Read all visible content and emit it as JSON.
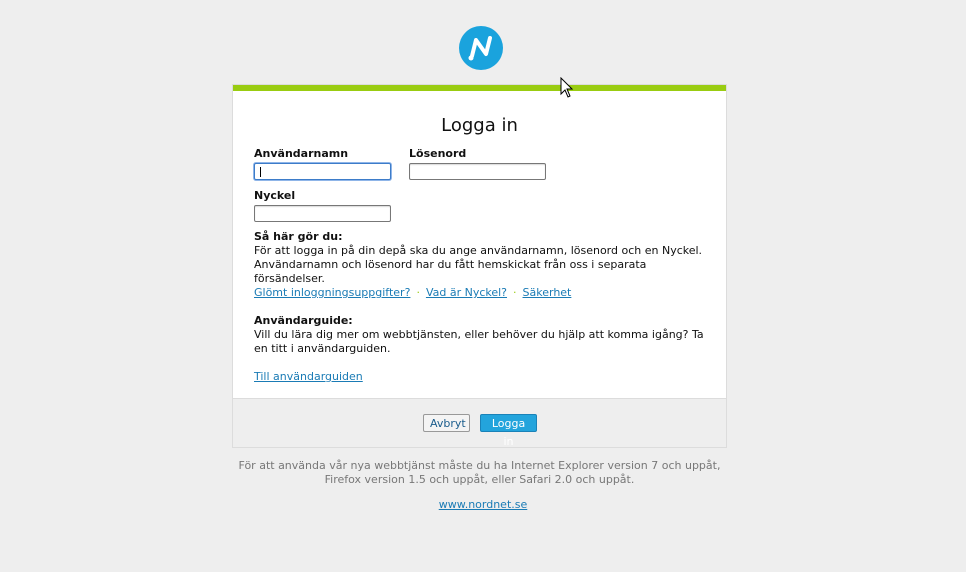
{
  "logo": {
    "icon": "nordnet-n-logo-icon",
    "color": "#1aa3dd"
  },
  "login": {
    "title": "Logga in",
    "username_label": "Användarnamn",
    "password_label": "Lösenord",
    "key_label": "Nyckel",
    "username_value": "",
    "password_value": "",
    "key_value": "",
    "howto_heading": "Så här gör du:",
    "howto_text": "För att logga in på din depå ska du ange användarnamn, lösenord och en Nyckel. Användarnamn och lösenord har du fått hemskickat från oss i separata försändelser.",
    "links": [
      "Glömt inloggningsuppgifter?",
      "Vad är Nyckel?",
      "Säkerhet"
    ],
    "guide_heading": "Användarguide:",
    "guide_text": "Vill du lära dig mer om webbtjänsten, eller behöver du hjälp att komma igång? Ta en titt i användarguiden.",
    "guide_link": "Till användarguiden",
    "cancel_label": "Avbryt",
    "submit_label": "Logga in"
  },
  "footer": {
    "note": "För att använda vår nya webbtjänst måste du ha Internet Explorer version 7 och uppåt, Firefox version 1.5 och uppåt, eller Safari 2.0 och uppåt.",
    "site_link": "www.nordnet.se"
  },
  "colors": {
    "accent_bar": "#99cc11",
    "button_primary": "#23a4dc",
    "link": "#1a7bb5"
  }
}
